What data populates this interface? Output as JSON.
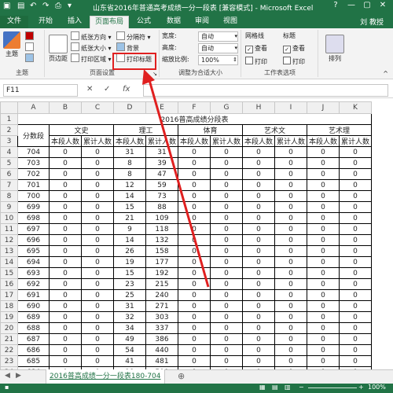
{
  "titlebar": {
    "title": "山东省2016年普通高考成绩一分一段表 [兼容模式] - Microsoft Excel",
    "help": "?",
    "minimize": "—",
    "restore": "▢",
    "close": "✕"
  },
  "tabs": [
    "文件",
    "开始",
    "插入",
    "页面布局",
    "公式",
    "数据",
    "审阅",
    "视图"
  ],
  "user": "刘 教授",
  "ribbon": {
    "theme_label": "主题",
    "theme_group": "主题",
    "margins": "页边距",
    "orientation": "纸张方向",
    "size": "纸张大小",
    "print_area": "打印区域",
    "breaks": "分隔符",
    "background": "背景",
    "print_titles": "打印标题",
    "page_setup_group": "页面设置",
    "width_label": "宽度:",
    "width_value": "自动",
    "height_label": "高度:",
    "height_value": "自动",
    "scale_label": "缩放比例:",
    "scale_value": "100%",
    "scale_group": "调整为合适大小",
    "gridlines": "网格线",
    "headings": "标题",
    "view": "查看",
    "print": "打印",
    "sheet_options_group": "工作表选项",
    "arrange": "排列"
  },
  "formula_bar": {
    "name_box": "F11",
    "fx": "fx",
    "cancel": "✕",
    "enter": "✓"
  },
  "sheet": {
    "col_letters": [
      "A",
      "B",
      "C",
      "D",
      "E",
      "F",
      "G",
      "H",
      "I",
      "J",
      "K"
    ],
    "title": "2016普高成绩分段表",
    "score_header": "分数段",
    "categories": [
      "文史",
      "理工",
      "体育",
      "艺术文",
      "艺术理"
    ],
    "sub_a": "本段人数",
    "sub_b": "累计人数",
    "rows": [
      [
        "704",
        "0",
        "0",
        "31",
        "31",
        "0",
        "0",
        "0",
        "0",
        "0",
        "0"
      ],
      [
        "703",
        "0",
        "0",
        "8",
        "39",
        "0",
        "0",
        "0",
        "0",
        "0",
        "0"
      ],
      [
        "702",
        "0",
        "0",
        "8",
        "47",
        "0",
        "0",
        "0",
        "0",
        "0",
        "0"
      ],
      [
        "701",
        "0",
        "0",
        "12",
        "59",
        "0",
        "0",
        "0",
        "0",
        "0",
        "0"
      ],
      [
        "700",
        "0",
        "0",
        "14",
        "73",
        "0",
        "0",
        "0",
        "0",
        "0",
        "0"
      ],
      [
        "699",
        "0",
        "0",
        "15",
        "88",
        "0",
        "0",
        "0",
        "0",
        "0",
        "0"
      ],
      [
        "698",
        "0",
        "0",
        "21",
        "109",
        "0",
        "0",
        "0",
        "0",
        "0",
        "0"
      ],
      [
        "697",
        "0",
        "0",
        "9",
        "118",
        "0",
        "0",
        "0",
        "0",
        "0",
        "0"
      ],
      [
        "696",
        "0",
        "0",
        "14",
        "132",
        "0",
        "0",
        "0",
        "0",
        "0",
        "0"
      ],
      [
        "695",
        "0",
        "0",
        "26",
        "158",
        "0",
        "0",
        "0",
        "0",
        "0",
        "0"
      ],
      [
        "694",
        "0",
        "0",
        "19",
        "177",
        "0",
        "0",
        "0",
        "0",
        "0",
        "0"
      ],
      [
        "693",
        "0",
        "0",
        "15",
        "192",
        "0",
        "0",
        "0",
        "0",
        "0",
        "0"
      ],
      [
        "692",
        "0",
        "0",
        "23",
        "215",
        "0",
        "0",
        "0",
        "0",
        "0",
        "0"
      ],
      [
        "691",
        "0",
        "0",
        "25",
        "240",
        "0",
        "0",
        "0",
        "0",
        "0",
        "0"
      ],
      [
        "690",
        "0",
        "0",
        "31",
        "271",
        "0",
        "0",
        "0",
        "0",
        "0",
        "0"
      ],
      [
        "689",
        "0",
        "0",
        "32",
        "303",
        "0",
        "0",
        "0",
        "0",
        "0",
        "0"
      ],
      [
        "688",
        "0",
        "0",
        "34",
        "337",
        "0",
        "0",
        "0",
        "0",
        "0",
        "0"
      ],
      [
        "687",
        "0",
        "0",
        "49",
        "386",
        "0",
        "0",
        "0",
        "0",
        "0",
        "0"
      ],
      [
        "686",
        "0",
        "0",
        "54",
        "440",
        "0",
        "0",
        "0",
        "0",
        "0",
        "0"
      ],
      [
        "685",
        "0",
        "0",
        "41",
        "481",
        "0",
        "0",
        "0",
        "0",
        "0",
        "0"
      ],
      [
        "684",
        "0",
        "0",
        "19",
        "500",
        "0",
        "0",
        "0",
        "0",
        "0",
        "0"
      ],
      [
        "683",
        "0",
        "0",
        "37",
        "537",
        "0",
        "0",
        "0",
        "0",
        "0",
        "0"
      ],
      [
        "682",
        "0",
        "0",
        "34",
        "571",
        "0",
        "0",
        "0",
        "0",
        "0",
        "0"
      ],
      [
        "681",
        "0",
        "0",
        "63",
        "634",
        "0",
        "0",
        "0",
        "0",
        "0",
        "0"
      ]
    ]
  },
  "sheet_tab": "2016普高成绩一分一段表180-704",
  "status": {
    "zoom": "100%"
  },
  "colors": {
    "excel_green": "#217346",
    "highlight_red": "#e02020"
  }
}
